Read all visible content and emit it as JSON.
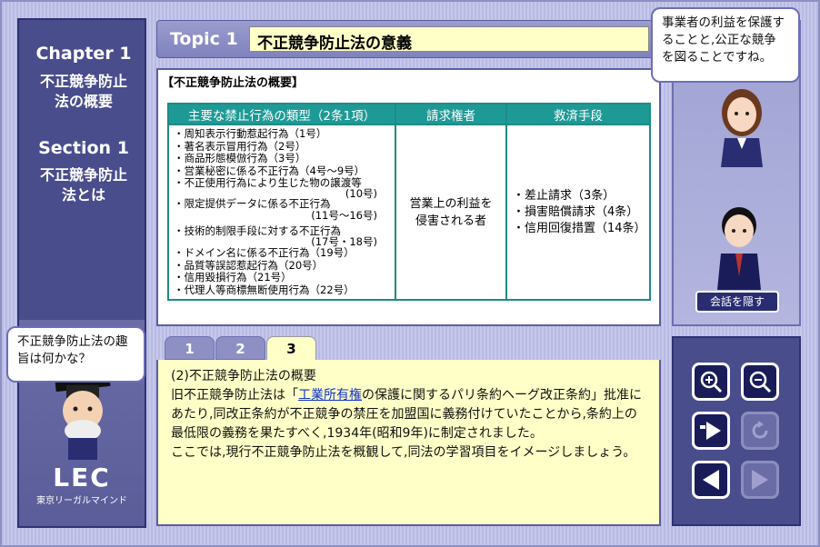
{
  "chapter": {
    "label": "Chapter 1",
    "title_l1": "不正競争防止",
    "title_l2": "法の概要"
  },
  "section": {
    "label": "Section 1",
    "title_l1": "不正競争防止",
    "title_l2": "法とは"
  },
  "logo": {
    "name": "LEC",
    "small": "東京リーガルマインド"
  },
  "teacher_bubble": {
    "l1": "不正競争防止法の趣",
    "l2": "旨は何かな？"
  },
  "woman_bubble": {
    "l1": "事業者の利益を保護す",
    "l2": "ることと,公正な競争",
    "l3": "を図ることですね。"
  },
  "topic": {
    "label": "Topic 1",
    "title": "不正競争防止法の意義"
  },
  "content": {
    "title": "【不正競争防止法の概要】",
    "headers": [
      "主要な禁止行為の類型（2条1項）",
      "請求権者",
      "救済手段"
    ],
    "items": [
      "・周知表示行動惹起行為（1号）",
      "・著名表示冒用行為（2号）",
      "・商品形態模倣行為（3号）",
      "・営業秘密に係る不正行為（4号～9号）",
      "・不正使用行為により生じた物の譲渡等",
      "(10号)",
      "・限定提供データに係る不正行為",
      "(11号～16号)",
      "・技術的制限手段に対する不正行為",
      "(17号・18号)",
      "・ドメイン名に係る不正行為（19号）",
      "・品質等誤認惹起行為（20号）",
      "・信用毀損行為（21号）",
      "・代理人等商標無断使用行為（22号）"
    ],
    "claim_l1": "営業上の利益を",
    "claim_l2": "侵害される者",
    "remedies": [
      "・差止請求（3条）",
      "・損害賠償請求（4条）",
      "・信用回復措置（14条）"
    ]
  },
  "tabs": [
    "1",
    "2",
    "3"
  ],
  "text": {
    "heading": "(2)不正競争防止法の概要",
    "p1_a": "旧不正競争防止法は「",
    "p1_link": "工業所有権",
    "p1_b": "の保護に関するパリ条約ヘーグ改正条約」批准にあたり,同改正条約が不正競争の禁圧を加盟国に義務付けていたことから,条約上の最低限の義務を果たすべく,1934年(昭和9年)に制定されました。",
    "p2": "ここでは,現行不正競争防止法を概観して,同法の学習項目をイメージしましょう。"
  },
  "hide_button": "会話を隠す",
  "controls": {
    "zoom_in": "zoom-in-icon",
    "zoom_out": "zoom-out-icon",
    "skip": "skip-icon",
    "replay": "replay-icon",
    "prev": "prev-icon",
    "next": "next-icon"
  }
}
